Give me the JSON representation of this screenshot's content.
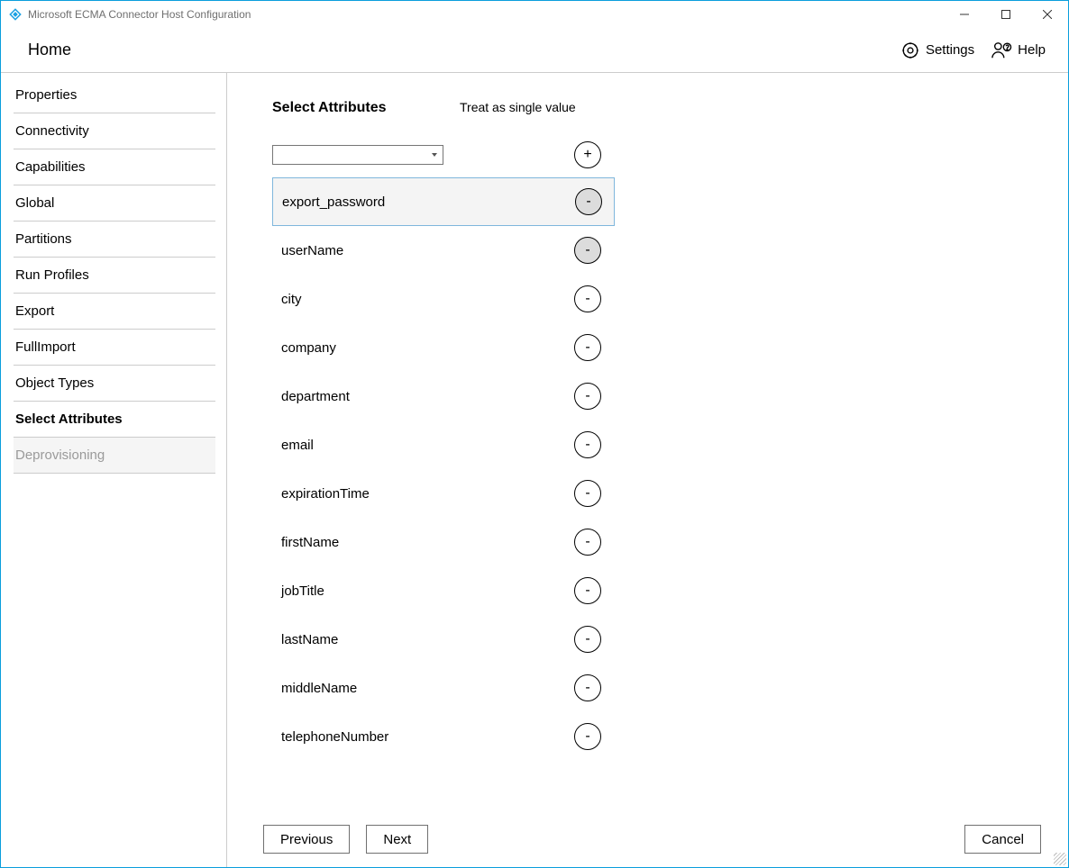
{
  "window": {
    "title": "Microsoft ECMA Connector Host Configuration"
  },
  "win_controls": {
    "min": "minimize",
    "max": "maximize",
    "close": "close"
  },
  "header": {
    "title": "Home",
    "settings": "Settings",
    "help": "Help"
  },
  "sidebar": {
    "items": [
      {
        "label": "Properties",
        "state": "normal"
      },
      {
        "label": "Connectivity",
        "state": "normal"
      },
      {
        "label": "Capabilities",
        "state": "normal"
      },
      {
        "label": "Global",
        "state": "normal"
      },
      {
        "label": "Partitions",
        "state": "normal"
      },
      {
        "label": "Run Profiles",
        "state": "normal"
      },
      {
        "label": "Export",
        "state": "normal"
      },
      {
        "label": "FullImport",
        "state": "normal"
      },
      {
        "label": "Object Types",
        "state": "normal"
      },
      {
        "label": "Select Attributes",
        "state": "active"
      },
      {
        "label": "Deprovisioning",
        "state": "disabled"
      }
    ]
  },
  "main": {
    "heading_attr": "Select Attributes",
    "heading_treat": "Treat as single value",
    "add_symbol": "+",
    "remove_symbol": "-",
    "attributes": [
      {
        "name": "export_password",
        "selected": true,
        "filled_btn": true
      },
      {
        "name": "userName",
        "selected": false,
        "filled_btn": true
      },
      {
        "name": "city",
        "selected": false,
        "filled_btn": false
      },
      {
        "name": "company",
        "selected": false,
        "filled_btn": false
      },
      {
        "name": "department",
        "selected": false,
        "filled_btn": false
      },
      {
        "name": "email",
        "selected": false,
        "filled_btn": false
      },
      {
        "name": "expirationTime",
        "selected": false,
        "filled_btn": false
      },
      {
        "name": "firstName",
        "selected": false,
        "filled_btn": false
      },
      {
        "name": "jobTitle",
        "selected": false,
        "filled_btn": false
      },
      {
        "name": "lastName",
        "selected": false,
        "filled_btn": false
      },
      {
        "name": "middleName",
        "selected": false,
        "filled_btn": false
      },
      {
        "name": "telephoneNumber",
        "selected": false,
        "filled_btn": false
      }
    ]
  },
  "footer": {
    "previous": "Previous",
    "next": "Next",
    "cancel": "Cancel"
  }
}
